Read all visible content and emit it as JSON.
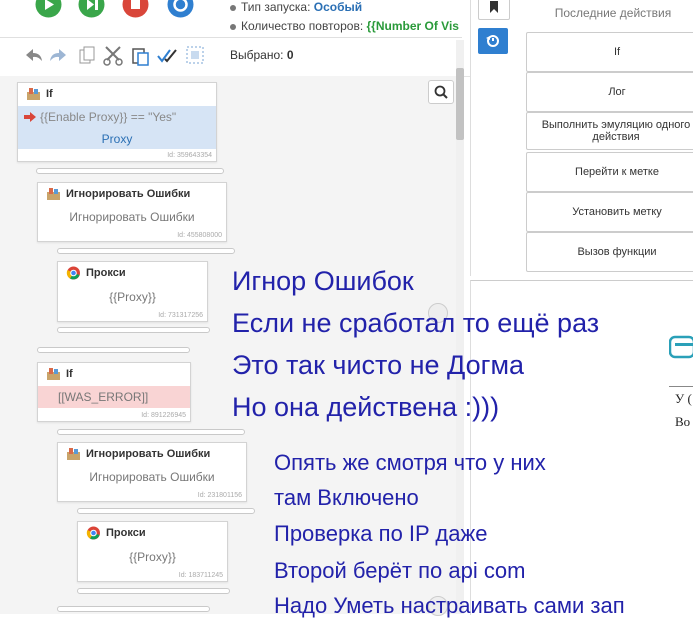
{
  "header": {
    "launch_type_label": "Тип запуска:",
    "launch_type_value": "Особый",
    "repeat_label": "Количество повторов:",
    "repeat_value": "{{Number Of Vis",
    "selected_label": "Выбрано:",
    "selected_value": "0"
  },
  "right_panel": {
    "history_label": "Последние действия",
    "actions": [
      "If",
      "Лог",
      "Выполнить эмуляцию одного действия",
      "Перейти к метке",
      "Установить метку",
      "Вызов функции"
    ]
  },
  "bottom_right": {
    "line1": "У (",
    "line2": "Во"
  },
  "blocks": [
    {
      "title": "If",
      "body": "{{Enable Proxy}} == \"Yes\"",
      "sub": "Proxy",
      "id": "Id: 359643354"
    },
    {
      "title": "Игнорировать Ошибки",
      "body": "Игнорировать Ошибки",
      "id": "Id: 455808000"
    },
    {
      "title": "Прокси",
      "body": "{{Proxy}}",
      "id": "Id: 731317256"
    },
    {
      "title": "If",
      "body": "[[WAS_ERROR]]",
      "id": "Id: 891226945"
    },
    {
      "title": "Игнорировать Ошибки",
      "body": "Игнорировать Ошибки",
      "id": "Id: 231801156"
    },
    {
      "title": "Прокси",
      "body": "{{Proxy}}",
      "id": "Id: 183711245"
    }
  ],
  "notes": {
    "big": [
      "Игнор Ошибок",
      "Если не сработал то ещё раз",
      "Это так чисто не Догма",
      "Но она действена :)))"
    ],
    "small": [
      "Опять же смотря что у них",
      "там Включено",
      "Проверка по IP даже",
      "Второй берёт по api com",
      "Надо Уметь настраивать сами зап"
    ]
  },
  "colors": {
    "annotation": "#2222aa",
    "if_highlight": "#d6e4f5",
    "error_highlight": "#f9d4d4",
    "side_button_blue": "#2f7fd0"
  }
}
